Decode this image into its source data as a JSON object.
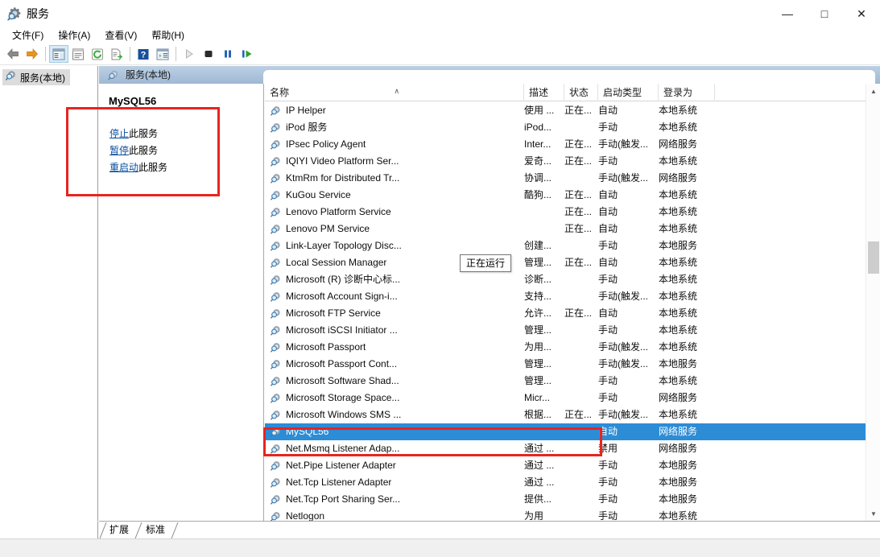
{
  "window": {
    "title": "服务",
    "icon": "services-gear-icon",
    "minimize": "—",
    "maximize": "□",
    "close": "✕"
  },
  "menubar": [
    {
      "label": "文件(F)",
      "name": "menu-file"
    },
    {
      "label": "操作(A)",
      "name": "menu-action"
    },
    {
      "label": "查看(V)",
      "name": "menu-view"
    },
    {
      "label": "帮助(H)",
      "name": "menu-help"
    }
  ],
  "toolbar": [
    {
      "name": "back-arrow-icon",
      "glyph": "←",
      "state": "enabled"
    },
    {
      "name": "forward-arrow-icon",
      "glyph": "→",
      "state": "enabled"
    },
    {
      "name": "show-hide-tree-icon",
      "glyph": "▤",
      "state": "selected"
    },
    {
      "name": "properties-icon",
      "glyph": "▣",
      "state": "enabled"
    },
    {
      "name": "refresh-icon",
      "glyph": "↻",
      "state": "enabled"
    },
    {
      "name": "export-list-icon",
      "glyph": "▥",
      "state": "enabled"
    },
    {
      "name": "help-icon",
      "glyph": "?",
      "state": "enabled"
    },
    {
      "name": "show-details-icon",
      "glyph": "▦",
      "state": "enabled"
    },
    {
      "name": "start-service-icon",
      "glyph": "▶",
      "state": "disabled"
    },
    {
      "name": "stop-service-icon",
      "glyph": "■",
      "state": "enabled"
    },
    {
      "name": "pause-service-icon",
      "glyph": "‖",
      "state": "enabled"
    },
    {
      "name": "restart-service-icon",
      "glyph": "▶‖",
      "state": "enabled"
    }
  ],
  "tree": {
    "root_label": "服务(本地)",
    "root_icon": "services-node-icon"
  },
  "pane": {
    "header_title": "服务(本地)",
    "header_icon": "services-node-icon"
  },
  "detail": {
    "service_name": "MySQL56",
    "links": [
      {
        "link_text": "停止",
        "tail_text": "此服务",
        "name": "stop-this-service-link"
      },
      {
        "link_text": "暂停",
        "tail_text": "此服务",
        "name": "pause-this-service-link"
      },
      {
        "link_text": "重启动",
        "tail_text": "此服务",
        "name": "restart-this-service-link"
      }
    ]
  },
  "list": {
    "columns": [
      {
        "label": "名称",
        "name": "column-name",
        "sorted": true,
        "sort_mark": "∧"
      },
      {
        "label": "描述",
        "name": "column-description",
        "sorted": false,
        "sort_mark": ""
      },
      {
        "label": "状态",
        "name": "column-status",
        "sorted": false,
        "sort_mark": ""
      },
      {
        "label": "启动类型",
        "name": "column-startup-type",
        "sorted": false,
        "sort_mark": ""
      },
      {
        "label": "登录为",
        "name": "column-logon-as",
        "sorted": false,
        "sort_mark": ""
      }
    ],
    "rows": [
      {
        "name": "IP Helper",
        "description": "使用 ...",
        "status": "正在...",
        "startup": "自动",
        "logon": "本地系统",
        "selected": false
      },
      {
        "name": "iPod 服务",
        "description": "iPod...",
        "status": "",
        "startup": "手动",
        "logon": "本地系统",
        "selected": false
      },
      {
        "name": "IPsec Policy Agent",
        "description": "Inter...",
        "status": "正在...",
        "startup": "手动(触发...",
        "logon": "网络服务",
        "selected": false
      },
      {
        "name": "IQIYI Video Platform Ser...",
        "description": "爱奇...",
        "status": "正在...",
        "startup": "手动",
        "logon": "本地系统",
        "selected": false
      },
      {
        "name": "KtmRm for Distributed Tr...",
        "description": "协调...",
        "status": "",
        "startup": "手动(触发...",
        "logon": "网络服务",
        "selected": false
      },
      {
        "name": "KuGou Service",
        "description": "酷狗...",
        "status": "正在...",
        "startup": "自动",
        "logon": "本地系统",
        "selected": false
      },
      {
        "name": "Lenovo Platform Service",
        "description": "",
        "status": "正在...",
        "startup": "自动",
        "logon": "本地系统",
        "selected": false
      },
      {
        "name": "Lenovo PM Service",
        "description": "",
        "status": "正在...",
        "startup": "自动",
        "logon": "本地系统",
        "selected": false
      },
      {
        "name": "Link-Layer Topology Disc...",
        "description": "创建...",
        "status": "",
        "startup": "手动",
        "logon": "本地服务",
        "selected": false
      },
      {
        "name": "Local Session Manager",
        "description": "管理...",
        "status": "正在...",
        "startup": "自动",
        "logon": "本地系统",
        "selected": false
      },
      {
        "name": "Microsoft (R) 诊断中心标...",
        "description": "诊断...",
        "status": "",
        "startup": "手动",
        "logon": "本地系统",
        "selected": false
      },
      {
        "name": "Microsoft Account Sign-i...",
        "description": "支持...",
        "status": "",
        "startup": "手动(触发...",
        "logon": "本地系统",
        "selected": false
      },
      {
        "name": "Microsoft FTP Service",
        "description": "允许...",
        "status": "正在...",
        "startup": "自动",
        "logon": "本地系统",
        "selected": false
      },
      {
        "name": "Microsoft iSCSI Initiator ...",
        "description": "管理...",
        "status": "",
        "startup": "手动",
        "logon": "本地系统",
        "selected": false
      },
      {
        "name": "Microsoft Passport",
        "description": "为用...",
        "status": "",
        "startup": "手动(触发...",
        "logon": "本地系统",
        "selected": false
      },
      {
        "name": "Microsoft Passport Cont...",
        "description": "管理...",
        "status": "",
        "startup": "手动(触发...",
        "logon": "本地服务",
        "selected": false
      },
      {
        "name": "Microsoft Software Shad...",
        "description": "管理...",
        "status": "",
        "startup": "手动",
        "logon": "本地系统",
        "selected": false
      },
      {
        "name": "Microsoft Storage Space...",
        "description": "Micr...",
        "status": "",
        "startup": "手动",
        "logon": "网络服务",
        "selected": false
      },
      {
        "name": "Microsoft Windows SMS ...",
        "description": "根据...",
        "status": "正在...",
        "startup": "手动(触发...",
        "logon": "本地系统",
        "selected": false
      },
      {
        "name": "MySQL56",
        "description": "",
        "status": "",
        "startup": "自动",
        "logon": "网络服务",
        "selected": true
      },
      {
        "name": "Net.Msmq Listener Adap...",
        "description": "通过 ...",
        "status": "",
        "startup": "禁用",
        "logon": "网络服务",
        "selected": false
      },
      {
        "name": "Net.Pipe Listener Adapter",
        "description": "通过 ...",
        "status": "",
        "startup": "手动",
        "logon": "本地服务",
        "selected": false
      },
      {
        "name": "Net.Tcp Listener Adapter",
        "description": "通过 ...",
        "status": "",
        "startup": "手动",
        "logon": "本地服务",
        "selected": false
      },
      {
        "name": "Net.Tcp Port Sharing Ser...",
        "description": "提供...",
        "status": "",
        "startup": "手动",
        "logon": "本地服务",
        "selected": false
      },
      {
        "name": "Netlogon",
        "description": "为用",
        "status": "",
        "startup": "手动",
        "logon": "本地系统",
        "selected": false
      }
    ],
    "tooltip": {
      "text": "正在运行",
      "name": "status-tooltip"
    },
    "scrollbar": {
      "up_glyph": "▲",
      "down_glyph": "▼"
    }
  },
  "tabs": [
    {
      "label": "扩展",
      "name": "tab-extended",
      "active": false
    },
    {
      "label": "标准",
      "name": "tab-standard",
      "active": true
    }
  ],
  "annotations": [
    {
      "name": "annotation-detail-links-box",
      "color": "#e8241f"
    },
    {
      "name": "annotation-mysql56-row-box",
      "color": "#e8241f"
    }
  ]
}
